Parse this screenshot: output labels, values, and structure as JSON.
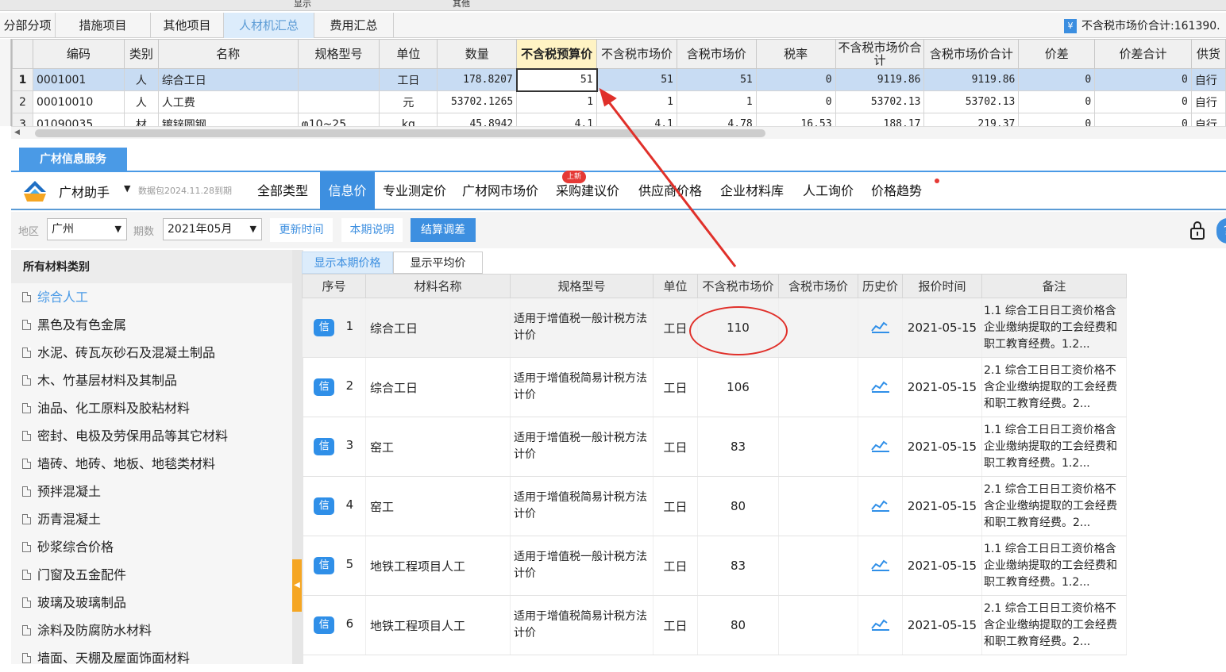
{
  "topstrip": {
    "left": "显示",
    "right": "其他"
  },
  "tabs": [
    {
      "label": "分部分项"
    },
    {
      "label": "措施项目"
    },
    {
      "label": "其他项目"
    },
    {
      "label": "人材机汇总"
    },
    {
      "label": "费用汇总"
    }
  ],
  "total": {
    "icon": "yen-icon",
    "text": "不含税市场价合计:161390."
  },
  "grid": {
    "headers": [
      "编码",
      "类别",
      "名称",
      "规格型号",
      "单位",
      "数量",
      "不含税预算价",
      "不含税市场价",
      "含税市场价",
      "税率",
      "不含税市场价合计",
      "含税市场价合计",
      "价差",
      "价差合计",
      "供货"
    ],
    "rows": [
      {
        "no": "1",
        "code": "0001001",
        "cat": "人",
        "name": "综合工日",
        "spec": "",
        "unit": "工日",
        "qty": "178.8207",
        "budget": "51",
        "mkt": "51",
        "mkttax": "51",
        "rate": "0",
        "sum": "9119.86",
        "sumtax": "9119.86",
        "diff": "0",
        "diffsum": "0",
        "supply": "自行"
      },
      {
        "no": "2",
        "code": "00010010",
        "cat": "人",
        "name": "人工费",
        "spec": "",
        "unit": "元",
        "qty": "53702.1265",
        "budget": "1",
        "mkt": "1",
        "mkttax": "1",
        "rate": "0",
        "sum": "53702.13",
        "sumtax": "53702.13",
        "diff": "0",
        "diffsum": "0",
        "supply": "自行"
      },
      {
        "no": "3",
        "code": "01090035",
        "cat": "材",
        "name": "镀锌圆钢",
        "spec": "φ10~25",
        "unit": "kg",
        "qty": "45.8942",
        "budget": "4.1",
        "mkt": "4.1",
        "mkttax": "4.78",
        "rate": "16.53",
        "sum": "188.17",
        "sumtax": "219.37",
        "diff": "0",
        "diffsum": "0",
        "supply": "自行"
      }
    ]
  },
  "panel": {
    "tab": "广材信息服务",
    "brand": "广材助手",
    "package": "数据包2024.11.28到期",
    "nav": [
      "全部类型",
      "信息价",
      "专业测定价",
      "广材网市场价",
      "采购建议价",
      "供应商价格",
      "企业材料库",
      "人工询价",
      "价格趋势"
    ],
    "new_badge": "上新",
    "region_label": "地区",
    "region": "广州",
    "period_label": "期数",
    "period": "2021年05月",
    "btn_update": "更新时间",
    "btn_desc": "本期说明",
    "btn_adjust": "结算调差"
  },
  "sidebar": {
    "title": "所有材料类别",
    "items": [
      "综合人工",
      "黑色及有色金属",
      "水泥、砖瓦灰砂石及混凝土制品",
      "木、竹基层材料及其制品",
      "油品、化工原料及胶粘材料",
      "密封、电极及劳保用品等其它材料",
      "墙砖、地砖、地板、地毯类材料",
      "预拌混凝土",
      "沥青混凝土",
      "砂浆综合价格",
      "门窗及五金配件",
      "玻璃及玻璃制品",
      "涂料及防腐防水材料",
      "墙面、天棚及屋面饰面材料"
    ]
  },
  "subtabs": [
    "显示本期价格",
    "显示平均价"
  ],
  "prices": {
    "headers": [
      "序号",
      "材料名称",
      "规格型号",
      "单位",
      "不含税市场价",
      "含税市场价",
      "历史价",
      "报价时间",
      "备注"
    ],
    "tag": "信",
    "rows": [
      {
        "no": "1",
        "name": "综合工日",
        "spec": "适用于增值税一般计税方法计价",
        "unit": "工日",
        "price": "110",
        "taxprice": "",
        "date": "2021-05-15",
        "note": "1.1 综合工日日工资价格含企业缴纳提取的工会经费和职工教育经费。1.2..."
      },
      {
        "no": "2",
        "name": "综合工日",
        "spec": "适用于增值税简易计税方法计价",
        "unit": "工日",
        "price": "106",
        "taxprice": "",
        "date": "2021-05-15",
        "note": "2.1 综合工日日工资价格不含企业缴纳提取的工会经费和职工教育经费。2..."
      },
      {
        "no": "3",
        "name": "窑工",
        "spec": "适用于增值税一般计税方法计价",
        "unit": "工日",
        "price": "83",
        "taxprice": "",
        "date": "2021-05-15",
        "note": "1.1 综合工日日工资价格含企业缴纳提取的工会经费和职工教育经费。1.2..."
      },
      {
        "no": "4",
        "name": "窑工",
        "spec": "适用于增值税简易计税方法计价",
        "unit": "工日",
        "price": "80",
        "taxprice": "",
        "date": "2021-05-15",
        "note": "2.1 综合工日日工资价格不含企业缴纳提取的工会经费和职工教育经费。2..."
      },
      {
        "no": "5",
        "name": "地铁工程项目人工",
        "spec": "适用于增值税一般计税方法计价",
        "unit": "工日",
        "price": "83",
        "taxprice": "",
        "date": "2021-05-15",
        "note": "1.1 综合工日日工资价格含企业缴纳提取的工会经费和职工教育经费。1.2..."
      },
      {
        "no": "6",
        "name": "地铁工程项目人工",
        "spec": "适用于增值税简易计税方法计价",
        "unit": "工日",
        "price": "80",
        "taxprice": "",
        "date": "2021-05-15",
        "note": "2.1 综合工日日工资价格不含企业缴纳提取的工会经费和职工教育经费。2..."
      }
    ]
  },
  "colors": {
    "accent": "#3d8fe0",
    "annotation": "#e0302a",
    "selected_row": "#c8dcf3",
    "header_highlight": "#fff3c4"
  }
}
